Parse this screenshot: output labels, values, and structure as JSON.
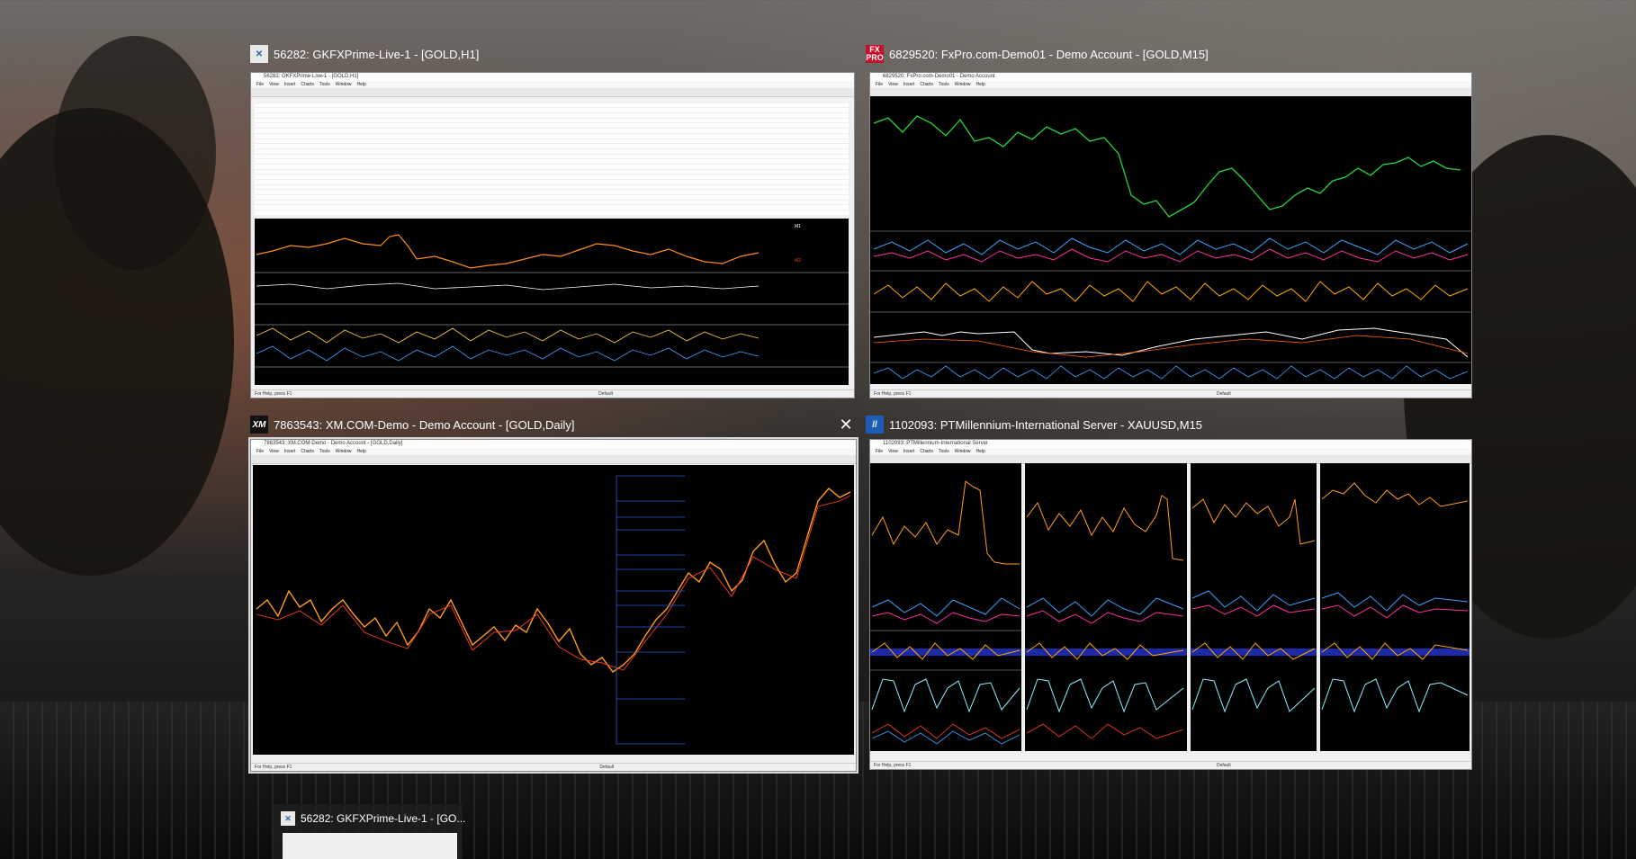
{
  "windows": [
    {
      "title": "56282: GKFXPrime-Live-1 - [GOLD,H1]",
      "icon": "gkfx-icon",
      "inner_title": "56282: GKFXPrime-Live-1 - [GOLD,H1]",
      "status_left": "For Help, press F1",
      "status_mid": "Default"
    },
    {
      "title": "6829520: FxPro.com-Demo01 - Demo Account - [GOLD,M15]",
      "icon": "fxpro-icon",
      "inner_title": "6829520: FxPro.com-Demo01 - Demo Account",
      "status_left": "For Help, press F1",
      "status_mid": "Default"
    },
    {
      "title": "7863543: XM.COM-Demo - Demo Account - [GOLD,Daily]",
      "icon": "xm-icon",
      "inner_title": "7863543: XM.COM-Demo - Demo Account - [GOLD,Daily]",
      "status_left": "For Help, press F1",
      "status_mid": "Default",
      "close_glyph": "✕"
    },
    {
      "title": "1102093: PTMillennium-International Server - XAUUSD,M15",
      "icon": "ptmillennium-icon",
      "inner_title": "1102093: PTMillennium-International Server",
      "status_left": "For Help, press F1",
      "status_mid": "Default"
    }
  ],
  "menu": [
    "File",
    "View",
    "Insert",
    "Charts",
    "Tools",
    "Window",
    "Help"
  ],
  "bottom_item": {
    "title": "56282: GKFXPrime-Live-1 - [GO..."
  },
  "colors": {
    "chart_bg": "#000000",
    "bull_candle": "#ffb000",
    "bear_candle": "#ff3b1f",
    "fxpro_line": "#27d43a",
    "macd_blue": "#3aa0ff",
    "macd_pink": "#ff2fa0",
    "osc_orange": "#ffa600",
    "osc_white": "#ffffff"
  }
}
